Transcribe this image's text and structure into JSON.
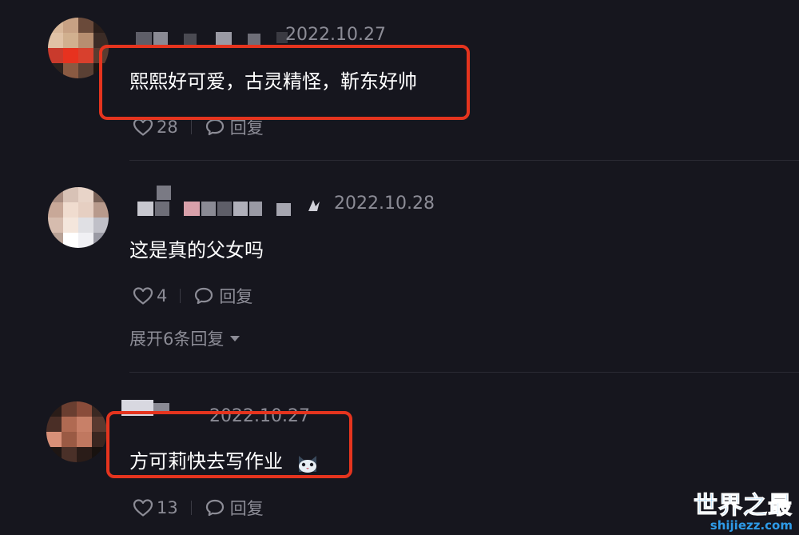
{
  "comments": [
    {
      "date": "2022.10.27",
      "text": "熙熙好可爱，古灵精怪，靳东好帅",
      "likes": "28",
      "reply_label": "回复",
      "highlighted": true
    },
    {
      "date": "2022.10.28",
      "text": "这是真的父女吗",
      "likes": "4",
      "reply_label": "回复",
      "expand_label": "展开6条回复",
      "highlighted": false
    },
    {
      "date": "2022.10.27",
      "text": "方可莉快去写作业",
      "likes": "13",
      "reply_label": "回复",
      "emoji": "cat-face-icon",
      "highlighted": true
    }
  ],
  "watermark": {
    "main": "世界之最",
    "sub": "shijiezz.com"
  },
  "colors": {
    "background": "#16161e",
    "highlight_border": "#e5341e",
    "meta_text": "#8c8c96",
    "watermark": "#2e9be8"
  }
}
